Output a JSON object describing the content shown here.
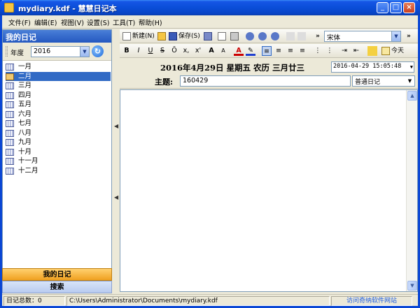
{
  "window": {
    "title": "mydiary.kdf - 慧慧日记本"
  },
  "title_buttons": {
    "minimize": "_",
    "maximize": "□",
    "close": "×"
  },
  "menu": [
    "文件(F)",
    "编辑(E)",
    "视图(V)",
    "设置(S)",
    "工具(T)",
    "帮助(H)"
  ],
  "left_pane": {
    "header": "我的日记",
    "year_label": "年度",
    "year_value": "2016",
    "months": [
      "一月",
      "二月",
      "三月",
      "四月",
      "五月",
      "六月",
      "七月",
      "八月",
      "九月",
      "十月",
      "十一月",
      "十二月"
    ],
    "selected_month_index": 1,
    "tab_diary": "我的日记",
    "tab_search": "搜索"
  },
  "toolbar1": {
    "new_label": "新建(N)",
    "save_label": "保存(S)",
    "font_value": "宋体",
    "overflow": "»"
  },
  "toolbar2": {
    "bold": "B",
    "italic": "I",
    "underline": "U",
    "strike": "S",
    "overline": "Ō",
    "subscript": "x,",
    "superscript": "x'",
    "grow": "A",
    "shrink": "A",
    "font_color": "A",
    "today_label": "今天"
  },
  "entry": {
    "date_line": "2016年4月29日  星期五   农历 三月廿三",
    "datetime_value": "2016-04-29 15:05:48",
    "subject_label": "主题:",
    "subject_value": "160429",
    "category_value": "普通日记"
  },
  "status": {
    "count": "日记总数：0",
    "path": "C:\\Users\\Administrator\\Documents\\mydiary.kdf",
    "link": "访问奇纳软件网站"
  }
}
